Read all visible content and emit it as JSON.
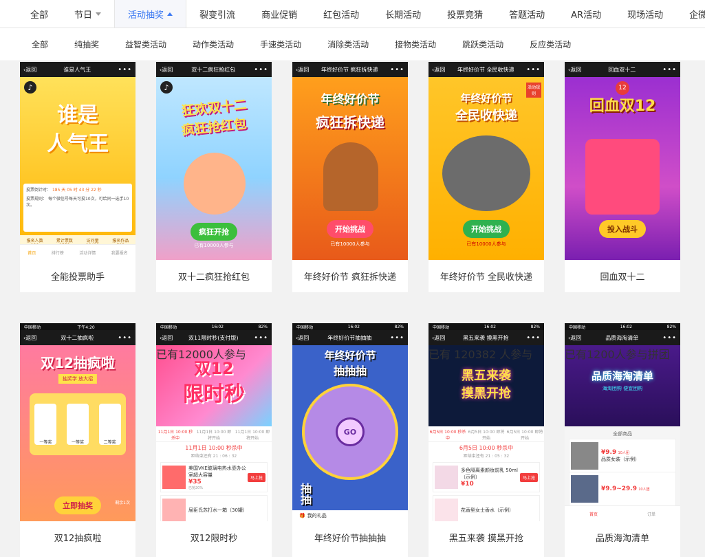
{
  "top_tabs": [
    {
      "label": "全部"
    },
    {
      "label": "节日"
    },
    {
      "label": "活动抽奖"
    },
    {
      "label": "裂变引流"
    },
    {
      "label": "商业促销"
    },
    {
      "label": "红包活动"
    },
    {
      "label": "长期活动"
    },
    {
      "label": "投票竞猜"
    },
    {
      "label": "答题活动"
    },
    {
      "label": "AR活动"
    },
    {
      "label": "现场活动"
    },
    {
      "label": "企微活动"
    }
  ],
  "sub_tabs": [
    {
      "label": "全部"
    },
    {
      "label": "纯抽奖"
    },
    {
      "label": "益智类活动"
    },
    {
      "label": "动作类活动"
    },
    {
      "label": "手速类活动"
    },
    {
      "label": "消除类活动"
    },
    {
      "label": "接物类活动"
    },
    {
      "label": "跳跃类活动"
    },
    {
      "label": "反应类活动"
    }
  ],
  "common": {
    "back": "返回",
    "dots": "•••",
    "music": "♪",
    "carrier": "中国移动",
    "time1": "下午4:20",
    "time2": "16:02",
    "battery": "82%"
  },
  "cards": [
    {
      "caption": "全能投票助手",
      "title": "谁是人气王",
      "headline1": "谁是",
      "headline2": "人气王",
      "countdown_label": "投票倒计时：",
      "countdown": "185 天 05 时 43 分 22 秒",
      "rules_label": "投票规则：",
      "rules": "每个微信号每天可投10次，可给同一选手10次。",
      "stats": [
        {
          "k": "报名人数",
          "v": "120"
        },
        {
          "k": "累计票数",
          "v": "1559"
        },
        {
          "k": "访问量",
          "v": "10419"
        },
        {
          "k": "报名作品",
          "v": "523"
        }
      ],
      "tabbar": [
        "首页",
        "排行榜",
        "活动详情",
        "我要报名"
      ]
    },
    {
      "caption": "双十二疯狂抢红包",
      "title": "双十二疯狂抢红包",
      "headline1": "狂欢双十二",
      "headline2": "疯狂抢红包",
      "cta": "疯狂开抢",
      "sub": "已有10000人参与"
    },
    {
      "caption": "年终好价节 疯狂拆快递",
      "title": "年终好价节 疯狂拆快递",
      "headline1": "年终好价节",
      "headline2": "疯狂拆快递",
      "cta": "开始挑战",
      "sub": "已有10000人参与"
    },
    {
      "caption": "年终好价节 全民收快递",
      "title": "年终好价节 全民收快递",
      "headline1": "年终好价节",
      "headline2": "全民收快递",
      "badge": "活动规则",
      "cta": "开始挑战",
      "sub": "已有10000人参与"
    },
    {
      "caption": "回血双十二",
      "title": "回血双十二",
      "headline1": "回血双12",
      "badge": "12",
      "cta": "投入战斗"
    },
    {
      "caption": "双12抽疯啦",
      "title": "双十二抽疯啦",
      "headline1": "双12抽疯啦",
      "ribbon": "抽奖学 放大招",
      "slots": [
        "一等奖",
        "一等奖",
        "二等奖"
      ],
      "cta": "立即抽奖",
      "chances": "剩余1次"
    },
    {
      "caption": "双12限时秒",
      "title": "双11限时秒(支付版)",
      "headline1": "双12",
      "headline2": "限时秒",
      "sub": "已有12000人参与",
      "slots": [
        "11月1日 10:00 秒杀中",
        "11月1日 10:00 即将开始",
        "11月1日 10:00 即将开始"
      ],
      "sale_title": "11月1日 10:00 秒杀中",
      "sale_countdown": "距结束还有 21 : 06 : 32",
      "product": "美国VKE玻璃电热水壶办公室超大容量",
      "price": "¥35",
      "sold": "已抢20%",
      "buy": "马上抢",
      "product2": "屈臣氏苏打水一箱（30罐）"
    },
    {
      "caption": "年终好价节抽抽抽",
      "title": "年终好价节抽抽抽",
      "headline1": "年终好价节",
      "headline2": "抽抽抽",
      "go": "GO",
      "side": "抽抽",
      "footer": "我的礼品"
    },
    {
      "caption": "黑五来袭 摸黑开抢",
      "title": "黑五来袭 摸黑开抢",
      "headline1": "黑五来袭",
      "headline2": "摸黑开抢",
      "sub": "已有 120382 人参与",
      "slots": [
        "6月5日 10:00 秒杀中",
        "6月5日 10:00 即将开始",
        "6月5日 10:00 即将开始"
      ],
      "sale_title": "6月5日 10:00 秒杀中",
      "sale_countdown": "距结束还有 21 : 05 : 32",
      "product": "多色隔离素颜妆前乳 50ml（示例）",
      "price": "¥10",
      "buy": "马上抢",
      "product2": "花香型女士香水（示例）"
    },
    {
      "caption": "品质海淘清单",
      "title": "品质海淘清单",
      "headline1": "品质海淘清单",
      "headline2": "海淘团购 便宜团购",
      "sub": "已有1200人参与拼团",
      "section": "全部商品",
      "p1_price": "¥9.9",
      "p1_tag": "10人团",
      "p1_name": "品质女装（示例）",
      "p2_price": "¥9.9~29.9",
      "p2_tag": "10人团",
      "tabbar": [
        "首页",
        "订单"
      ]
    }
  ]
}
